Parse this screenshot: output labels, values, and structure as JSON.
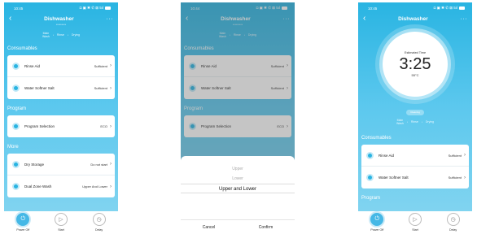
{
  "colors": {
    "accent": "#29b4e2",
    "card": "#ffffff"
  },
  "screen1": {
    "status_time": "10:45",
    "status_icons": "◘ ▣ ✱ ✆ ⊠ 5ıl",
    "title": "Dishwasher",
    "subtitle": "*********",
    "stages": [
      "Main\nWash",
      "Rinse",
      "Drying"
    ],
    "sections": {
      "consumables": "Consumables",
      "program": "Program",
      "more": "More"
    },
    "rows": {
      "rinse_aid": {
        "label": "Rinse Aid",
        "value": "Sufficient"
      },
      "salt": {
        "label": "Water Softner Salt",
        "value": "Sufficient"
      },
      "program": {
        "label": "Program Selection",
        "value": "ECO"
      },
      "dry": {
        "label": "Dry Storage",
        "value": "Do not start"
      },
      "dual": {
        "label": "Dual Zone Wash",
        "value": "Upper And Lower"
      }
    },
    "nav": {
      "power": "Power Off",
      "start": "Start",
      "delay": "Delay"
    }
  },
  "screen2": {
    "status_time": "10:44",
    "status_icons": "◘ ▣ ✱ ✆ ⊠ 5ıl",
    "title": "Dishwasher",
    "subtitle": "*********",
    "stages": [
      "Main\nWash",
      "Rinse",
      "Drying"
    ],
    "sections": {
      "consumables": "Consumables",
      "program": "Program"
    },
    "rows": {
      "rinse_aid": {
        "label": "Rinse Aid",
        "value": "Sufficient"
      },
      "salt": {
        "label": "Water Softner Salt",
        "value": "Sufficient"
      },
      "program": {
        "label": "Program Selection",
        "value": "ECO"
      }
    },
    "picker": {
      "options": [
        "Upper",
        "Lower",
        "Upper and Lower"
      ],
      "selected_index": 2,
      "cancel": "Cancel",
      "confirm": "Confirm"
    }
  },
  "screen3": {
    "status_time": "10:45",
    "status_icons": "◘ ▣ ✱ ✆ ⊠ 5ıl",
    "title": "Dishwasher",
    "dial": {
      "label": "Estimated Time",
      "time": "3:25",
      "temp": "55°C"
    },
    "pill": "Cleaning",
    "stages": [
      "Main\nWash",
      "Rinse",
      "Drying"
    ],
    "sections": {
      "consumables": "Consumables",
      "program": "Program"
    },
    "rows": {
      "rinse_aid": {
        "label": "Rinse Aid",
        "value": "Sufficient"
      },
      "salt": {
        "label": "Water Softner Salt",
        "value": "Sufficient"
      }
    },
    "nav": {
      "power": "Power Off",
      "start": "Start",
      "delay": "Delay"
    }
  }
}
